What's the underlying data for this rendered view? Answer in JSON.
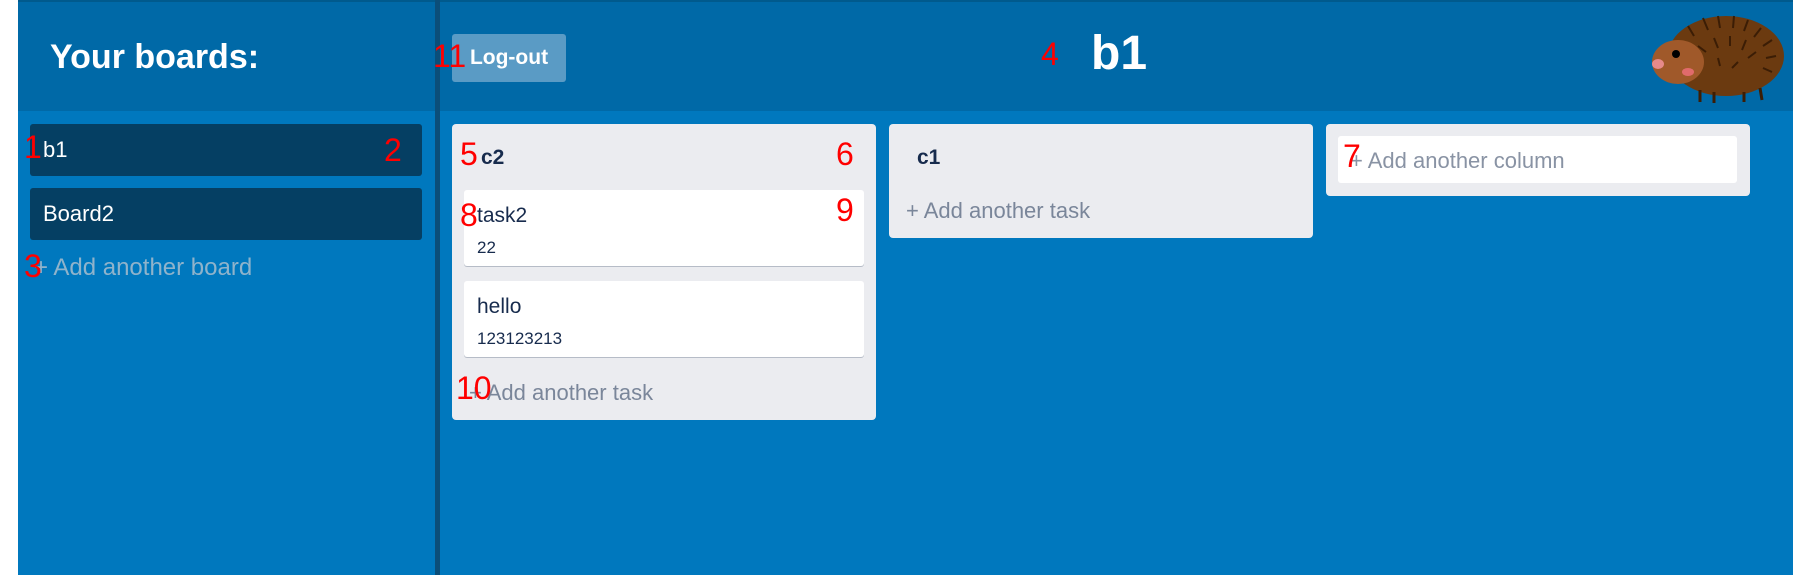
{
  "sidebar": {
    "title": "Your boards:",
    "boards": [
      {
        "label": "b1"
      },
      {
        "label": "Board2"
      }
    ],
    "add_board_label": "+ Add another board"
  },
  "header": {
    "logout_label": "Log-out",
    "board_title": "b1",
    "mascot_icon": "hedgehog-icon"
  },
  "columns": [
    {
      "title": "c2",
      "tasks": [
        {
          "title": "task2",
          "description": "22"
        },
        {
          "title": "hello",
          "description": "123123213"
        }
      ],
      "add_task_label": "+ Add another task"
    },
    {
      "title": "c1",
      "tasks": [],
      "add_task_label": "+ Add another task"
    }
  ],
  "add_column": {
    "placeholder": "+ Add another column"
  },
  "markers": [
    "1",
    "2",
    "3",
    "4",
    "5",
    "6",
    "7",
    "8",
    "9",
    "10",
    "11"
  ],
  "colors": {
    "background": "#0078be",
    "header": "#0069a7",
    "board_item": "#053f63",
    "column": "#ebecf0",
    "marker": "#ff0000"
  }
}
